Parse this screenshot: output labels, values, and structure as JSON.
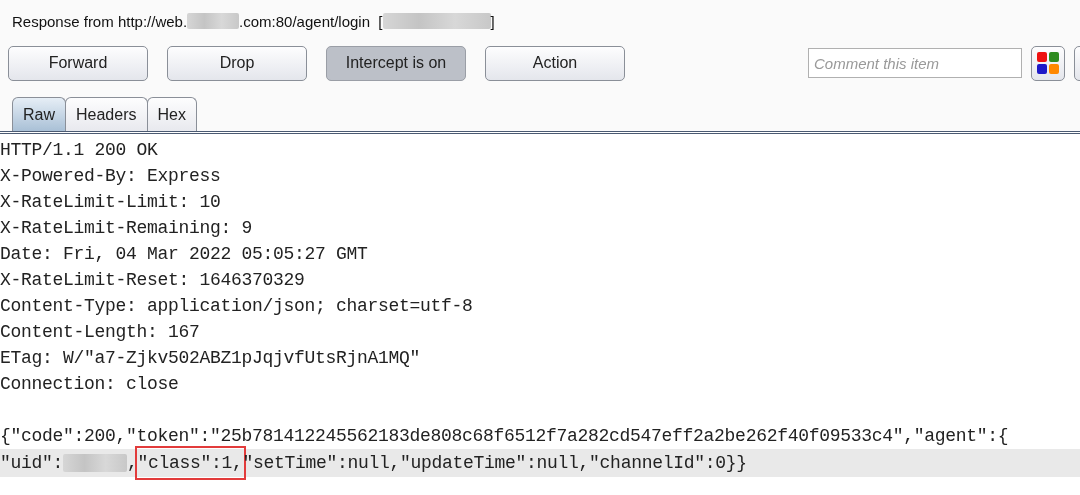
{
  "title": {
    "prefix": "Response from http://web.",
    "middle": ".com:80/agent/login  [",
    "suffix": "]"
  },
  "buttons": [
    {
      "label": "Forward",
      "selected": false
    },
    {
      "label": "Drop",
      "selected": false
    },
    {
      "label": "Intercept is on",
      "selected": true
    },
    {
      "label": "Action",
      "selected": false
    }
  ],
  "comment": {
    "placeholder": "Comment this item"
  },
  "tabs": [
    {
      "label": "Raw",
      "selected": true
    },
    {
      "label": "Headers",
      "selected": false
    },
    {
      "label": "Hex",
      "selected": false
    }
  ],
  "headers": [
    "HTTP/1.1 200 OK",
    "X-Powered-By: Express",
    "X-RateLimit-Limit: 10",
    "X-RateLimit-Remaining: 9",
    "Date: Fri, 04 Mar 2022 05:05:27 GMT",
    "X-RateLimit-Reset: 1646370329",
    "Content-Type: application/json; charset=utf-8",
    "Content-Length: 167",
    "ETag: W/\"a7-Zjkv502ABZ1pJqjvfUtsRjnA1MQ\"",
    "Connection: close"
  ],
  "body": {
    "line_1": "{\"code\":200,\"token\":\"25b781412245562183de808c68f6512f7a282cd547eff2a2be262f40f09533c4\",\"agent\":{",
    "line_2_start": "\"uid\":",
    "line_2_comma": ",",
    "highlighted": "\"class\":1,",
    "line_2_end": "\"setTime\":null,\"updateTime\":null,\"channelId\":0}}",
    "current_line": true
  }
}
